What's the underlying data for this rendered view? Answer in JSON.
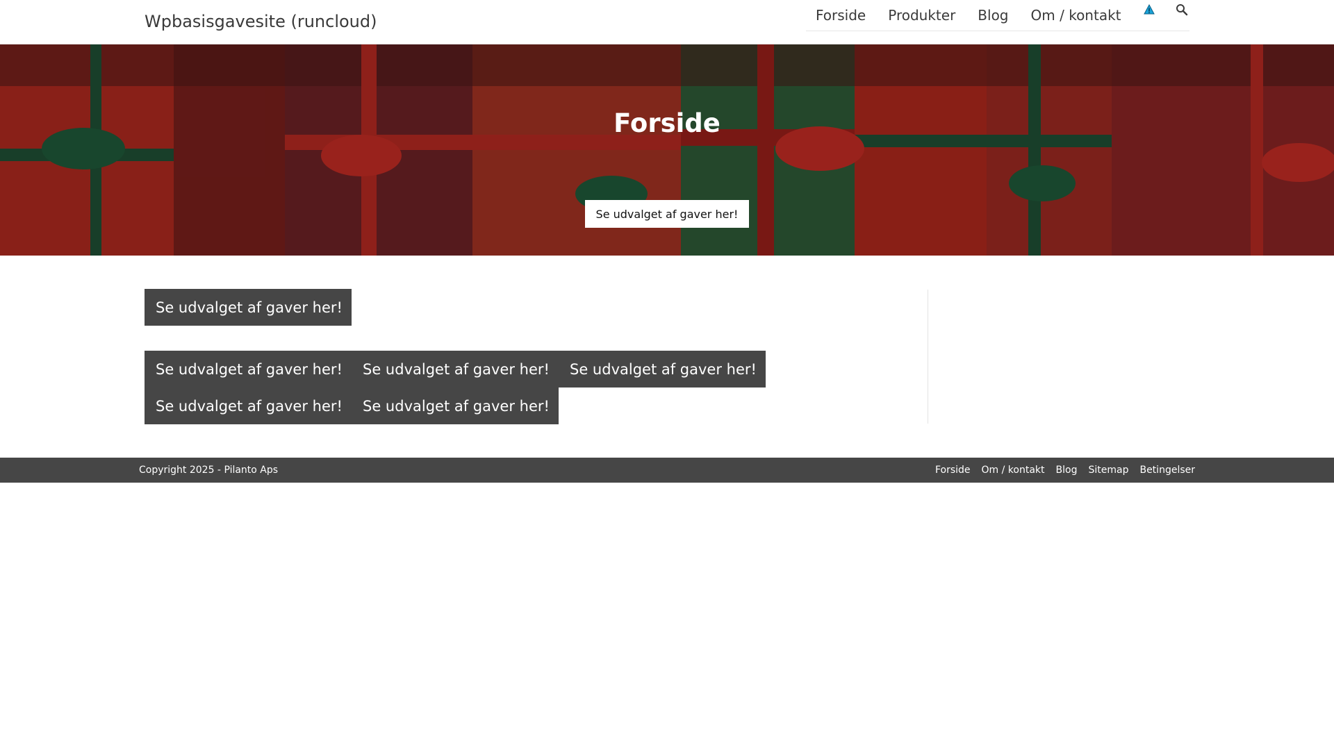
{
  "header": {
    "site_title": "Wpbasisgavesite (runcloud)",
    "nav": [
      "Forside",
      "Produkter",
      "Blog",
      "Om / kontakt"
    ],
    "icons": [
      "warning-icon",
      "search-icon"
    ]
  },
  "hero": {
    "title": "Forside",
    "button_label": "Se udvalget af gaver her!"
  },
  "content": {
    "single_button": "Se udvalget af gaver her!",
    "grid_buttons": [
      "Se udvalget af gaver her!",
      "Se udvalget af gaver her!",
      "Se udvalget af gaver her!",
      "Se udvalget af gaver her!",
      "Se udvalget af gaver her!"
    ]
  },
  "footer": {
    "copyright": "Copyright 2025 - Pilanto Aps",
    "links": [
      "Forside",
      "Om / kontakt",
      "Blog",
      "Sitemap",
      "Betingelser"
    ]
  },
  "colors": {
    "dark_button": "#464646",
    "footer_bg": "#464646",
    "hero_red": "#9b2a22",
    "hero_green": "#2f5a37"
  }
}
